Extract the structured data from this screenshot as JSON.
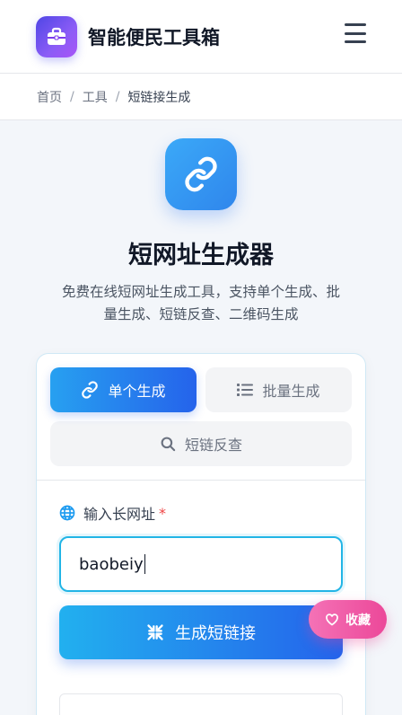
{
  "header": {
    "brand": "智能便民工具箱",
    "logo_icon": "toolbox-icon",
    "menu_icon": "hamburger-menu-icon"
  },
  "breadcrumb": {
    "items": [
      "首页",
      "工具",
      "短链接生成"
    ],
    "separator": "/"
  },
  "hero": {
    "icon": "link-icon",
    "title": "短网址生成器",
    "description": "免费在线短网址生成工具，支持单个生成、批量生成、短链反查、二维码生成"
  },
  "tabs": [
    {
      "label": "单个生成",
      "icon": "link-icon",
      "active": true
    },
    {
      "label": "批量生成",
      "icon": "list-icon",
      "active": false
    },
    {
      "label": "短链反查",
      "icon": "search-icon",
      "active": false
    }
  ],
  "form": {
    "label": "输入长网址",
    "required_mark": "*",
    "input_value": "baobeiy",
    "submit_label": "生成短链接"
  },
  "favorite": {
    "label": "收藏",
    "icon": "heart-icon"
  },
  "colors": {
    "accent_start": "#27a0f0",
    "accent_end": "#2563eb",
    "favorite": "#ec4899",
    "logo": "#6366f1"
  }
}
